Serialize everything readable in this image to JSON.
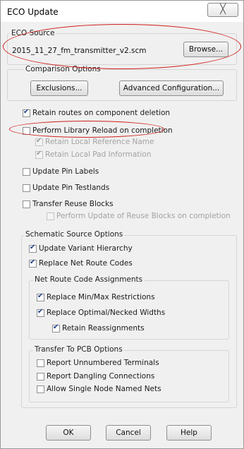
{
  "window": {
    "title": "ECO Update",
    "close_glyph": "╳"
  },
  "eco_source": {
    "label": "ECO Source",
    "filename": "2015_11_27_fm_transmitter_v2.scm",
    "browse": "Browse..."
  },
  "comparison": {
    "label": "Comparison Options",
    "exclusions": "Exclusions...",
    "advanced": "Advanced Configuration..."
  },
  "options": {
    "retain_routes": {
      "label": "Retain routes on component deletion",
      "checked": true
    },
    "perform_library_reload": {
      "label": "Perform Library Reload on completion",
      "checked": false
    },
    "retain_local_ref": {
      "label": "Retain Local Reference Name",
      "checked": true,
      "disabled": true
    },
    "retain_local_pad": {
      "label": "Retain Local Pad Information",
      "checked": true,
      "disabled": true
    },
    "update_pin_labels": {
      "label": "Update Pin Labels",
      "checked": false
    },
    "update_pin_testlands": {
      "label": "Update Pin Testlands",
      "checked": false
    },
    "transfer_reuse_blocks": {
      "label": "Transfer Reuse Blocks",
      "checked": false
    },
    "perform_update_reuse": {
      "label": "Perform Update of Reuse Blocks on completion",
      "checked": false,
      "disabled": true
    }
  },
  "schematic": {
    "label": "Schematic Source Options",
    "update_variant": {
      "label": "Update Variant Hierarchy",
      "checked": true
    },
    "replace_net_route": {
      "label": "Replace Net Route Codes",
      "checked": true
    },
    "net_route_group": {
      "label": "Net Route Code Assignments",
      "replace_minmax": {
        "label": "Replace Min/Max Restrictions",
        "checked": true
      },
      "replace_optimal": {
        "label": "Replace Optimal/Necked Widths",
        "checked": true
      },
      "retain_reassign": {
        "label": "Retain Reassignments",
        "checked": true
      }
    },
    "transfer_group": {
      "label": "Transfer To PCB Options",
      "report_unnumbered": {
        "label": "Report Unnumbered Terminals",
        "checked": false
      },
      "report_dangling": {
        "label": "Report Dangling Connections",
        "checked": false
      },
      "allow_single_node": {
        "label": "Allow Single Node Named Nets",
        "checked": false
      }
    }
  },
  "buttons": {
    "ok": "OK",
    "cancel": "Cancel",
    "help": "Help"
  },
  "annotation_color": "#d0201c"
}
